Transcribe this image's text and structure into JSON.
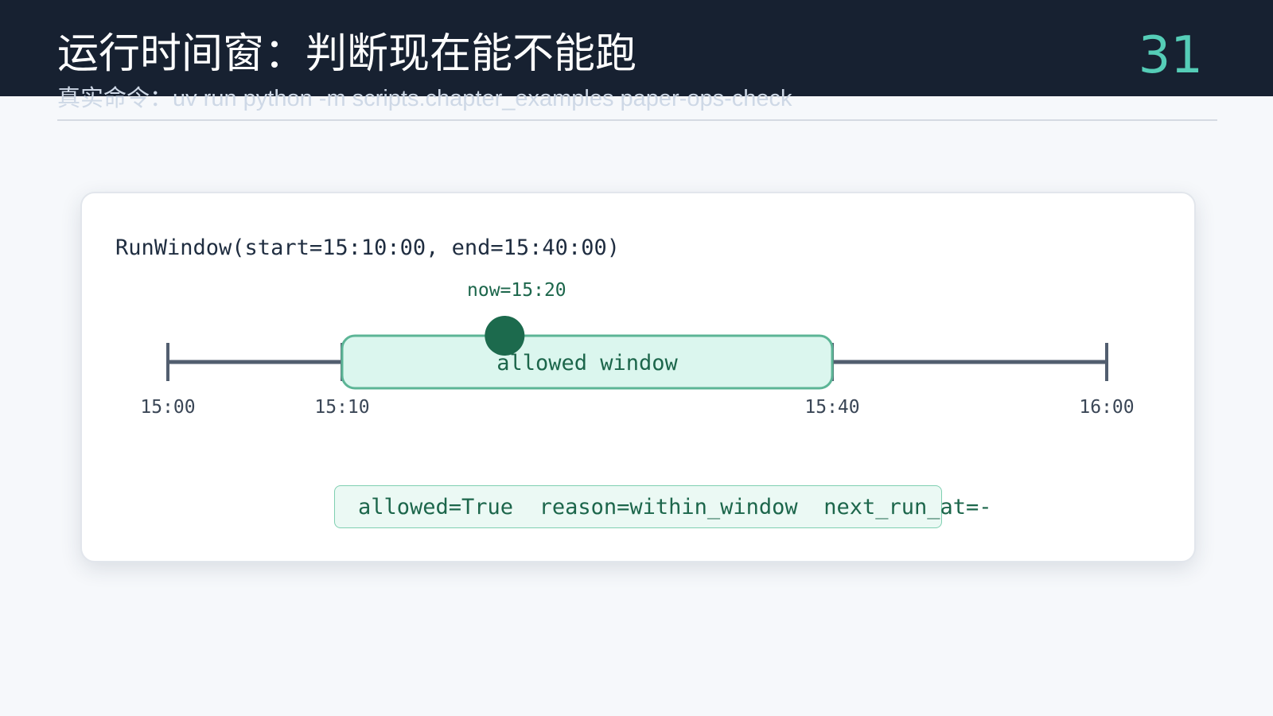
{
  "slide": {
    "title": "运行时间窗：判断现在能不能跑",
    "page_number": "31",
    "subtitle": "真实命令：uv run python -m scripts.chapter_examples paper-ops-check"
  },
  "diagram": {
    "code_line": "RunWindow(start=15:10:00, end=15:40:00)",
    "now_label": "now=15:20",
    "window_label": "allowed window",
    "ticks": [
      {
        "label": "15:00",
        "minutes": 0
      },
      {
        "label": "15:10",
        "minutes": 10
      },
      {
        "label": "15:40",
        "minutes": 40
      },
      {
        "label": "16:00",
        "minutes": 60
      }
    ],
    "window_start_minutes": 10,
    "window_end_minutes": 40,
    "now_minutes": 20,
    "result_line": "allowed=True  reason=within_window  next_run_at=-"
  },
  "colors": {
    "header_bg": "#172131",
    "accent": "#55cdb7",
    "axis": "#525e6f",
    "window_fill": "#dbf6ee",
    "window_stroke": "#5cb596",
    "now_dot": "#1c6a4d",
    "green_text": "#1c664b"
  }
}
